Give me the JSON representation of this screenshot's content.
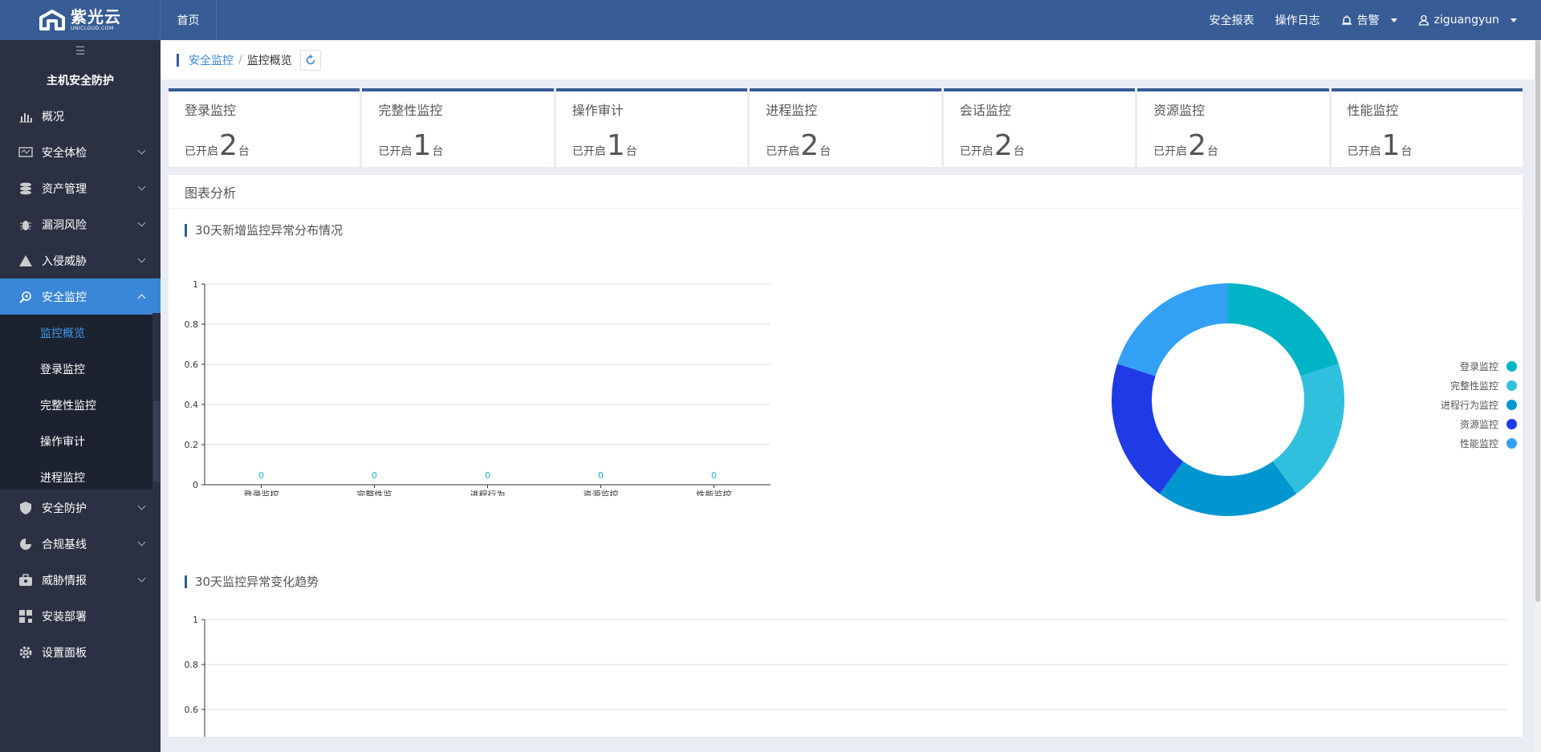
{
  "brand": {
    "name_cn": "紫光云",
    "name_en": "UNICLOUD.COM"
  },
  "header": {
    "home": "首页",
    "security_report": "安全报表",
    "operation_log": "操作日志",
    "alarm": "告警",
    "user": "ziguangyun"
  },
  "sidebar": {
    "toggle": "☰",
    "title": "主机安全防护",
    "items": [
      {
        "label": "概况",
        "icon": "bar-chart-icon"
      },
      {
        "label": "安全体检",
        "icon": "monitor-check-icon"
      },
      {
        "label": "资产管理",
        "icon": "database-icon"
      },
      {
        "label": "漏洞风险",
        "icon": "bug-icon"
      },
      {
        "label": "入侵威胁",
        "icon": "warning-triangle-icon"
      },
      {
        "label": "安全监控",
        "icon": "search-shield-icon"
      },
      {
        "label": "安全防护",
        "icon": "shield-icon"
      },
      {
        "label": "合规基线",
        "icon": "pie-icon"
      },
      {
        "label": "威胁情报",
        "icon": "briefcase-icon"
      },
      {
        "label": "安装部署",
        "icon": "grid-icon"
      },
      {
        "label": "设置面板",
        "icon": "gear-icon"
      }
    ],
    "sub_items": [
      "监控概览",
      "登录监控",
      "完整性监控",
      "操作审计",
      "进程监控"
    ]
  },
  "breadcrumb": {
    "parent": "安全监控",
    "sep": "/",
    "current": "监控概览"
  },
  "cards": [
    {
      "title": "登录监控",
      "prefix": "已开启",
      "value": "2",
      "unit": "台"
    },
    {
      "title": "完整性监控",
      "prefix": "已开启",
      "value": "1",
      "unit": "台"
    },
    {
      "title": "操作审计",
      "prefix": "已开启",
      "value": "1",
      "unit": "台"
    },
    {
      "title": "进程监控",
      "prefix": "已开启",
      "value": "2",
      "unit": "台"
    },
    {
      "title": "会话监控",
      "prefix": "已开启",
      "value": "2",
      "unit": "台"
    },
    {
      "title": "资源监控",
      "prefix": "已开启",
      "value": "2",
      "unit": "台"
    },
    {
      "title": "性能监控",
      "prefix": "已开启",
      "value": "1",
      "unit": "台"
    }
  ],
  "panel": {
    "title": "图表分析",
    "section1": "30天新增监控异常分布情况",
    "section2": "30天监控异常变化趋势"
  },
  "chart_data": [
    {
      "type": "bar",
      "categories": [
        "登录监控",
        "完整性监控",
        "进程行为监控",
        "资源监控",
        "性能监控"
      ],
      "values": [
        0,
        0,
        0,
        0,
        0
      ],
      "data_labels": [
        "0",
        "0",
        "0",
        "0",
        "0"
      ],
      "yticks": [
        "0",
        "0.2",
        "0.4",
        "0.6",
        "0.8",
        "1"
      ],
      "ylim": [
        0,
        1
      ],
      "grid": true,
      "label_color": "#22aee0"
    },
    {
      "type": "pie",
      "donut": true,
      "labels": [
        "登录监控",
        "完整性监控",
        "进程行为监控",
        "资源监控",
        "性能监控"
      ],
      "values": [
        1,
        1,
        1,
        1,
        1
      ],
      "colors": [
        "#00b4c5",
        "#30c0de",
        "#0096d0",
        "#1f3be6",
        "#31a0f5"
      ],
      "legend_position": "right"
    },
    {
      "type": "line",
      "yticks": [
        "0.6",
        "0.8",
        "1"
      ],
      "ylim": [
        0,
        1
      ],
      "grid": true
    }
  ]
}
